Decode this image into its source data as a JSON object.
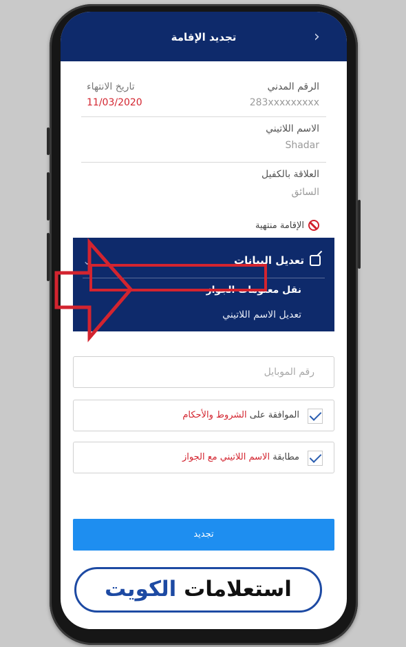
{
  "header": {
    "title": "تجديد الإقامة",
    "back_icon": "chevron-left-icon"
  },
  "fields": {
    "civil_id_label": "الرقم المدني",
    "civil_id_value": "283xxxxxxxxx",
    "expiry_label": "تاريخ الانتهاء",
    "expiry_value": "11/03/2020",
    "latin_name_label": "الاسم اللاتيني",
    "latin_name_value": "Shadar",
    "relation_label": "العلاقة بالكفيل",
    "relation_value": "السائق"
  },
  "status": {
    "text": "الإقامة منتهية",
    "icon": "prohibited-icon"
  },
  "menu": {
    "header": "تعديل البيانات",
    "items": [
      "نقل معلومات الجواز",
      "تعديل الاسم اللاتيني"
    ]
  },
  "form": {
    "mobile_placeholder": "رقم الموبايل",
    "agree_prefix": "الموافقة على",
    "agree_link": "الشروط والأحكام",
    "match_prefix": "مطابقة",
    "match_link": "الاسم اللاتيني مع الجواز"
  },
  "actions": {
    "renew": "تجديد"
  },
  "watermark": {
    "word1": "استعلامات",
    "word2": "الكويت"
  },
  "colors": {
    "navy": "#0e2a6b",
    "button_blue": "#1e8ef0",
    "red": "#d3242f",
    "logo_blue": "#1d4aa3"
  }
}
